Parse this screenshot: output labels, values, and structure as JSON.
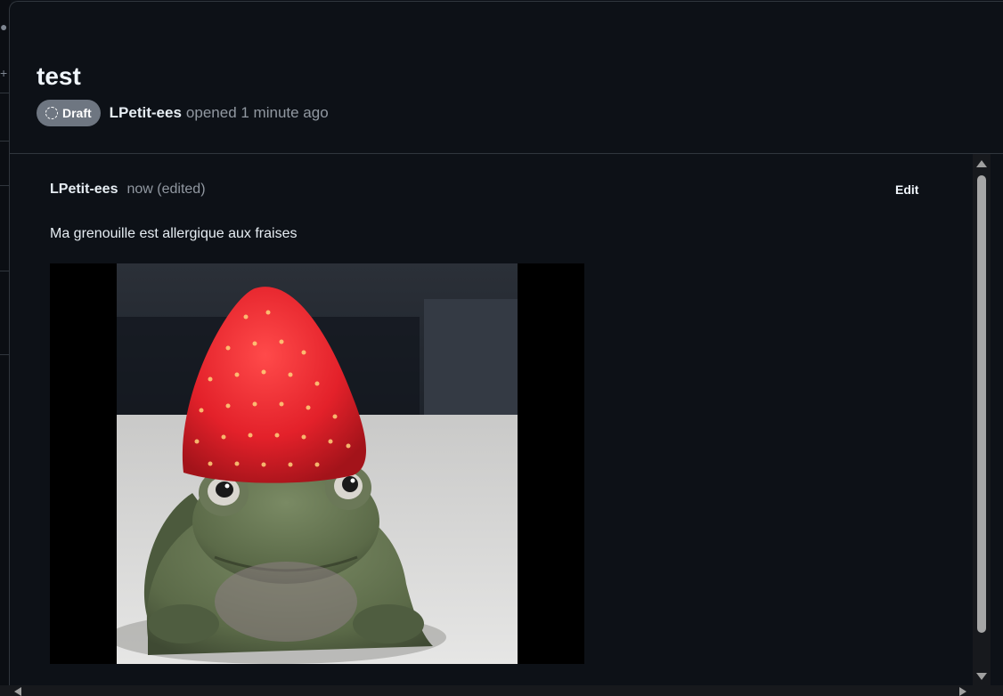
{
  "dialog": {
    "title": "test",
    "status_badge": "Draft",
    "author": "LPetit-ees",
    "opened_text": "opened 1 minute ago"
  },
  "comment": {
    "author": "LPetit-ees",
    "timestamp": "now (edited)",
    "edit_label": "Edit",
    "body": "Ma grenouille est allergique aux fraises",
    "image_alt": "frog wearing a strawberry hat"
  },
  "icons": {
    "draft": "draft-circle-icon",
    "scroll_up": "scroll-up-arrow-icon",
    "scroll_down": "scroll-down-arrow-icon",
    "scroll_left": "scroll-left-arrow-icon",
    "scroll_right": "scroll-right-arrow-icon"
  },
  "colors": {
    "background": "#0d1117",
    "border": "#30363d",
    "text": "#e6edf3",
    "muted": "#9198a1",
    "draft_badge": "#6e7681",
    "strawberry": "#e3212a",
    "frog": "#5b6a48"
  }
}
